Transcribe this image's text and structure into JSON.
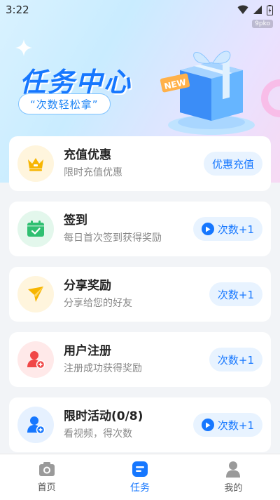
{
  "status": {
    "time": "3:22"
  },
  "watermark": "9pko",
  "hero": {
    "title": "任务中心",
    "subtitle": "“次数轻松拿”",
    "badge": "NEW"
  },
  "tasks": [
    {
      "title": "充值优惠",
      "desc": "限时充值优惠",
      "action": "优惠充值",
      "icon": "crown-icon",
      "color": "#f7b500",
      "has_play": false
    },
    {
      "title": "签到",
      "desc": "每日首次签到获得奖励",
      "action": "次数+1",
      "icon": "calendar-check-icon",
      "color": "#2fbf71",
      "has_play": true
    },
    {
      "title": "分享奖励",
      "desc": "分享给您的好友",
      "action": "次数+1",
      "icon": "send-icon",
      "color": "#f7b500",
      "has_play": false
    },
    {
      "title": "用户注册",
      "desc": "注册成功获得奖励",
      "action": "次数+1",
      "icon": "user-add-icon",
      "color": "#f04848",
      "has_play": false
    },
    {
      "title": "限时活动(0/8)",
      "desc": "看视频，得次数",
      "action": "次数+1",
      "icon": "user-add-icon",
      "color": "#1677ff",
      "has_play": true
    }
  ],
  "tabs": [
    {
      "label": "首页",
      "icon": "camera-icon"
    },
    {
      "label": "任务",
      "icon": "task-icon",
      "active": true
    },
    {
      "label": "我的",
      "icon": "user-icon"
    }
  ],
  "colors": {
    "accent": "#1677ff",
    "button_bg": "#e8f3ff"
  }
}
